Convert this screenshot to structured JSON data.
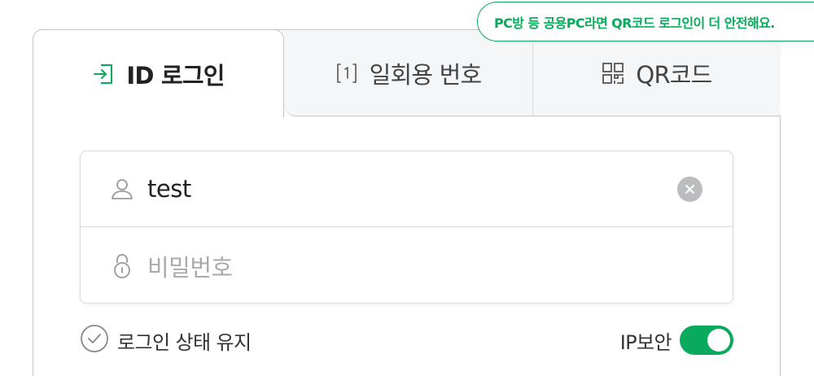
{
  "tooltip": {
    "text": "PC방 등 공용PC라면 QR코드 로그인이 더 안전해요."
  },
  "tabs": [
    {
      "label": "ID 로그인",
      "icon": "login-arrow-icon",
      "active": true
    },
    {
      "label": "일회용 번호",
      "icon": "one-time-number-icon",
      "active": false
    },
    {
      "label": "QR코드",
      "icon": "qr-code-icon",
      "active": false
    }
  ],
  "form": {
    "id_value": "test",
    "id_icon": "user-icon",
    "password_placeholder": "비밀번호",
    "password_icon": "lock-icon",
    "clear_icon": "clear-icon"
  },
  "options": {
    "keep_login_label": "로그인 상태 유지",
    "keep_login_checked": false,
    "ip_security_label": "IP보안",
    "ip_security_on": true
  },
  "colors": {
    "accent": "#09aa5c",
    "border": "#c6c6c6",
    "tab_inactive_bg": "#f5f6f7",
    "placeholder": "#aaaaaa"
  }
}
